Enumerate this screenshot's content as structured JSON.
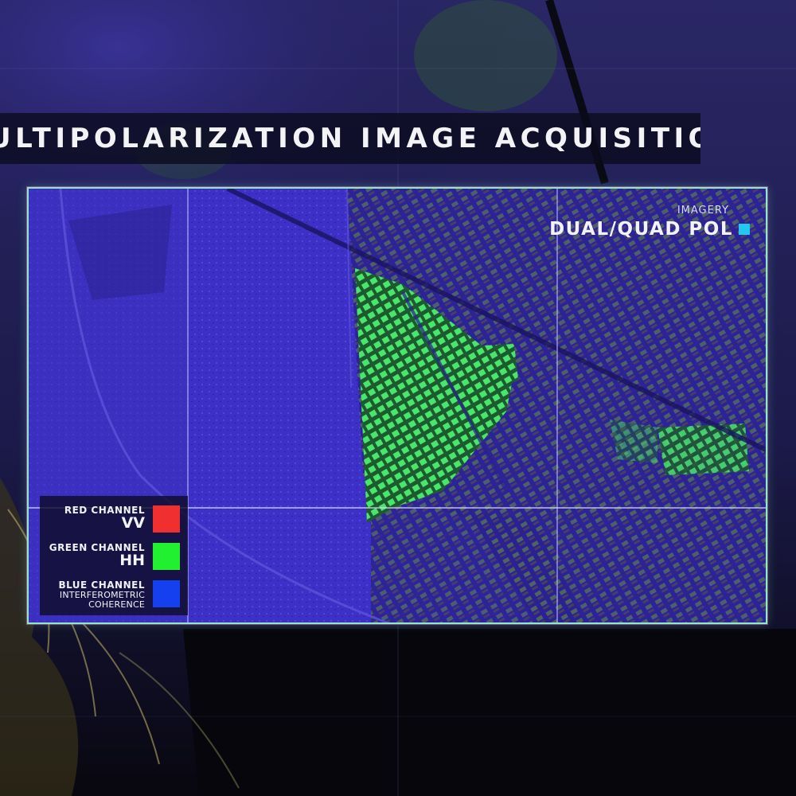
{
  "title": "ULTIPOLARIZATION IMAGE ACQUISITION",
  "imagery": {
    "label": "IMAGERY",
    "value": "DUAL/QUAD POL",
    "marker_color": "#22c8f0"
  },
  "legend": {
    "channels": [
      {
        "name": "RED CHANNEL",
        "value": "VV",
        "color": "#f03030"
      },
      {
        "name": "GREEN CHANNEL",
        "value": "HH",
        "color": "#20f030"
      },
      {
        "name": "BLUE CHANNEL",
        "value": "INTERFEROMETRIC COHERENCE",
        "color": "#1540f0"
      }
    ]
  },
  "colors": {
    "frame_border": "#8fe9c6",
    "image_tint": "#3a2cc8",
    "urban_green": "#40e060"
  }
}
